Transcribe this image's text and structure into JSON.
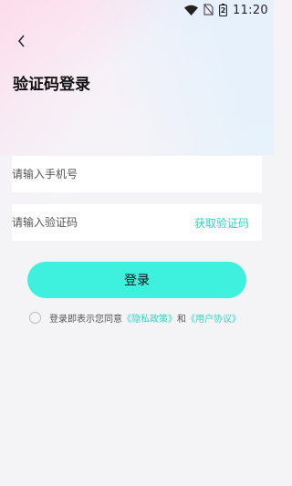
{
  "status_bar": {
    "time": "11:20",
    "battery_level": "2",
    "icons": [
      "wifi-icon",
      "no-sim-icon",
      "battery-icon"
    ]
  },
  "header": {
    "back_icon": "chevron-left-icon",
    "title": "验证码登录"
  },
  "form": {
    "phone_placeholder": "请输入手机号",
    "code_placeholder": "请输入验证码",
    "get_code_label": "获取验证码"
  },
  "login_button": {
    "label": "登录"
  },
  "agreement": {
    "prefix": "登录即表示您同意",
    "privacy_link": "《隐私政策》",
    "connector": "和",
    "terms_link": "《用户协议》"
  },
  "colors": {
    "accent": "#3df1de",
    "link": "#2fd6c3"
  }
}
